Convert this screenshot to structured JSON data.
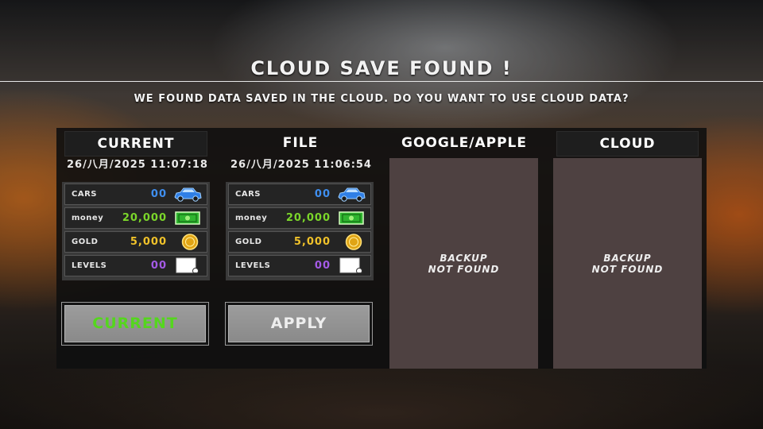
{
  "dialog": {
    "title": "CLOUD SAVE FOUND !",
    "subtitle": "WE FOUND DATA SAVED IN THE CLOUD. DO YOU WANT TO USE CLOUD DATA?"
  },
  "columns": {
    "current": {
      "header": "CURRENT",
      "date": "26/八月/2025 11:07:18",
      "button_label": "CURRENT",
      "stats": [
        {
          "label": "CARS",
          "value": "00",
          "icon": "car-icon",
          "color": "#3f8ff0"
        },
        {
          "label": "money",
          "value": "20,000",
          "icon": "cash-icon",
          "color": "#7bd62a"
        },
        {
          "label": "GOLD",
          "value": "5,000",
          "icon": "gold-coin-icon",
          "color": "#f0c22a"
        },
        {
          "label": "LEVELS",
          "value": "00",
          "icon": "certificate-icon",
          "color": "#a45ae6"
        }
      ]
    },
    "file": {
      "header": "FILE",
      "date": "26/八月/2025 11:06:54",
      "button_label": "APPLY",
      "stats": [
        {
          "label": "CARS",
          "value": "00",
          "icon": "car-icon",
          "color": "#3f8ff0"
        },
        {
          "label": "money",
          "value": "20,000",
          "icon": "cash-icon",
          "color": "#7bd62a"
        },
        {
          "label": "GOLD",
          "value": "5,000",
          "icon": "gold-coin-icon",
          "color": "#f0c22a"
        },
        {
          "label": "LEVELS",
          "value": "00",
          "icon": "certificate-icon",
          "color": "#a45ae6"
        }
      ]
    },
    "google_apple": {
      "header": "GOOGLE/APPLE",
      "message_line1": "BACKUP",
      "message_line2": "NOT FOUND"
    },
    "cloud": {
      "header": "CLOUD",
      "message_line1": "BACKUP",
      "message_line2": "NOT FOUND"
    }
  },
  "colors": {
    "current_button_text": "#55d61e",
    "apply_button_text": "#eeeeee",
    "backup_panel": "#4e4141"
  }
}
